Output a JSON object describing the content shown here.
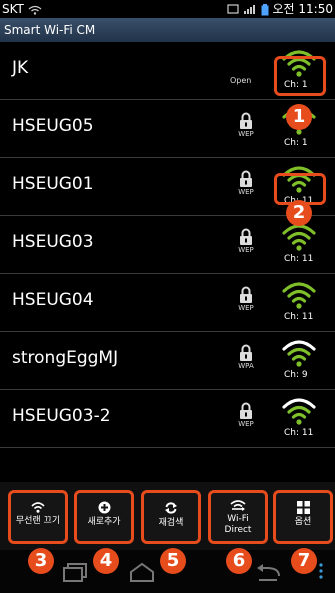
{
  "status": {
    "carrier": "SKT",
    "time": "오전 11:50"
  },
  "app": {
    "title": "Smart Wi-Fi CM"
  },
  "networks": [
    {
      "ssid": "JK",
      "security": "Open",
      "channel": "Ch: 1",
      "locked": false,
      "signal": 3
    },
    {
      "ssid": "HSEUG05",
      "security": "WEP",
      "channel": "Ch: 1",
      "locked": true,
      "signal": 3
    },
    {
      "ssid": "HSEUG01",
      "security": "WEP",
      "channel": "Ch: 11",
      "locked": true,
      "signal": 3
    },
    {
      "ssid": "HSEUG03",
      "security": "WEP",
      "channel": "Ch: 11",
      "locked": true,
      "signal": 3
    },
    {
      "ssid": "HSEUG04",
      "security": "WEP",
      "channel": "Ch: 11",
      "locked": true,
      "signal": 3
    },
    {
      "ssid": "strongEggMJ",
      "security": "WPA",
      "channel": "Ch: 9",
      "locked": true,
      "signal": 2
    },
    {
      "ssid": "HSEUG03-2",
      "security": "WEP",
      "channel": "Ch: 11",
      "locked": true,
      "signal": 2
    }
  ],
  "toolbar": {
    "wifi_off": "무선랜 끄기",
    "add_new": "새로추가",
    "rescan": "재검색",
    "wifi_direct_1": "Wi-Fi",
    "wifi_direct_2": "Direct",
    "options": "옵션"
  },
  "badges": [
    "1",
    "2",
    "3",
    "4",
    "5",
    "6",
    "7"
  ],
  "colors": {
    "wifi_green": "#7fbf2a",
    "wifi_white": "#ffffff",
    "badge": "#e74c1d"
  }
}
